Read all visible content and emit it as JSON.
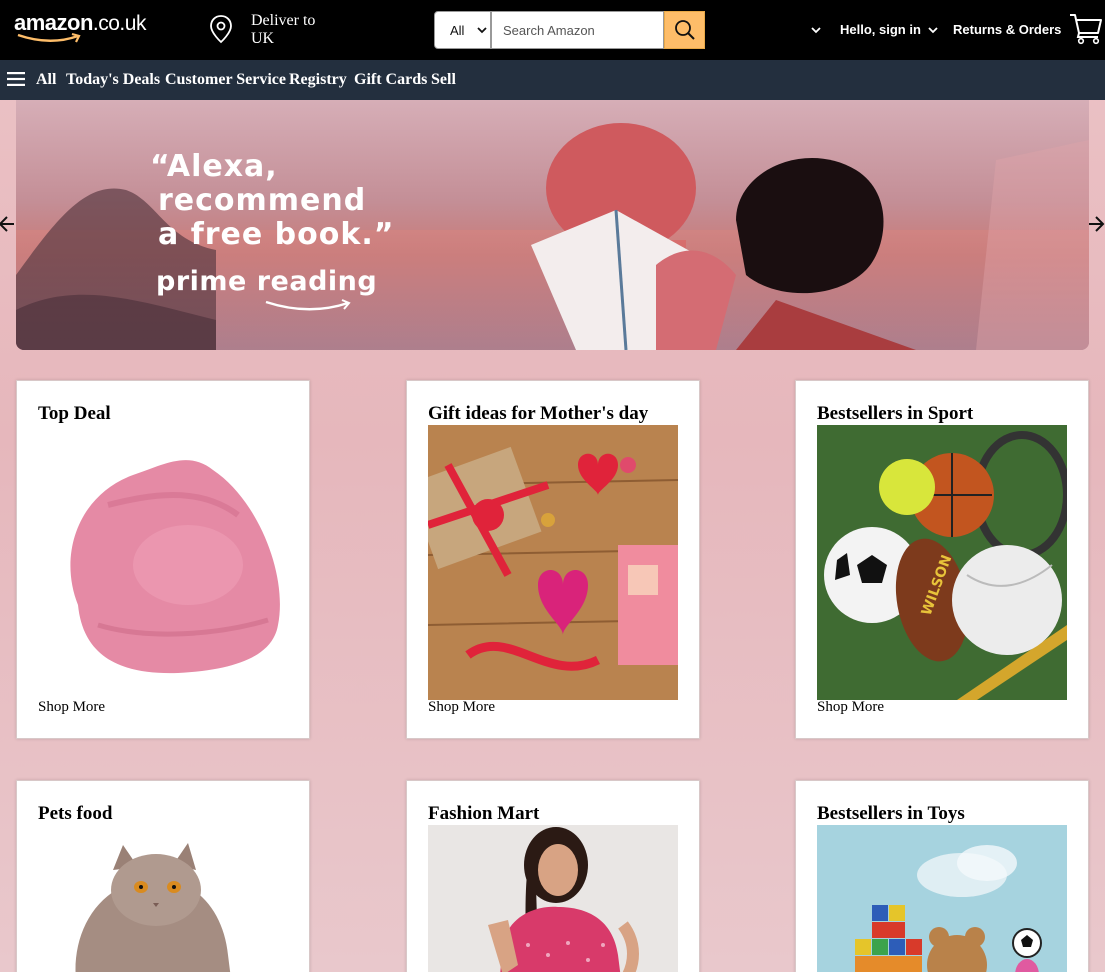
{
  "header": {
    "logo_main": "amazon",
    "logo_tld": ".co.uk",
    "deliver_line1": "Deliver to",
    "deliver_line2": "UK",
    "search": {
      "category": "All",
      "placeholder": "Search Amazon"
    },
    "signin_label": "Hello, sign in",
    "returns_label": "Returns & Orders",
    "icons": [
      "location-pin-icon",
      "search-icon",
      "chevron-down-icon",
      "cart-icon"
    ],
    "accent_color": "#febd69"
  },
  "nav": {
    "menu_icon": "hamburger-icon",
    "items": [
      "All",
      "Today's Deals",
      "Customer Service",
      "Registry",
      "Gift Cards",
      "Sell"
    ],
    "background": "#232f3e"
  },
  "hero": {
    "quote_lines": [
      "“Alexa,",
      "recommend",
      "a free book.”"
    ],
    "subtitle": "prime reading",
    "prev_icon": "arrow-left-icon",
    "next_icon": "arrow-right-icon"
  },
  "cards": [
    {
      "title": "Top Deal",
      "image": "pink-bean-bag",
      "link": "Shop More"
    },
    {
      "title": "Gift ideas for Mother's day",
      "image": "gift-boxes-with-ribbons",
      "link": "Shop More"
    },
    {
      "title": "Bestsellers in Sport",
      "image": "sports-balls",
      "link": "Shop More"
    },
    {
      "title": "Pets food",
      "image": "grey-cat",
      "link": ""
    },
    {
      "title": "Fashion Mart",
      "image": "woman-in-pink-kurta",
      "link": ""
    },
    {
      "title": "Bestsellers in Toys",
      "image": "toy-blocks-and-teddy",
      "link": ""
    }
  ]
}
